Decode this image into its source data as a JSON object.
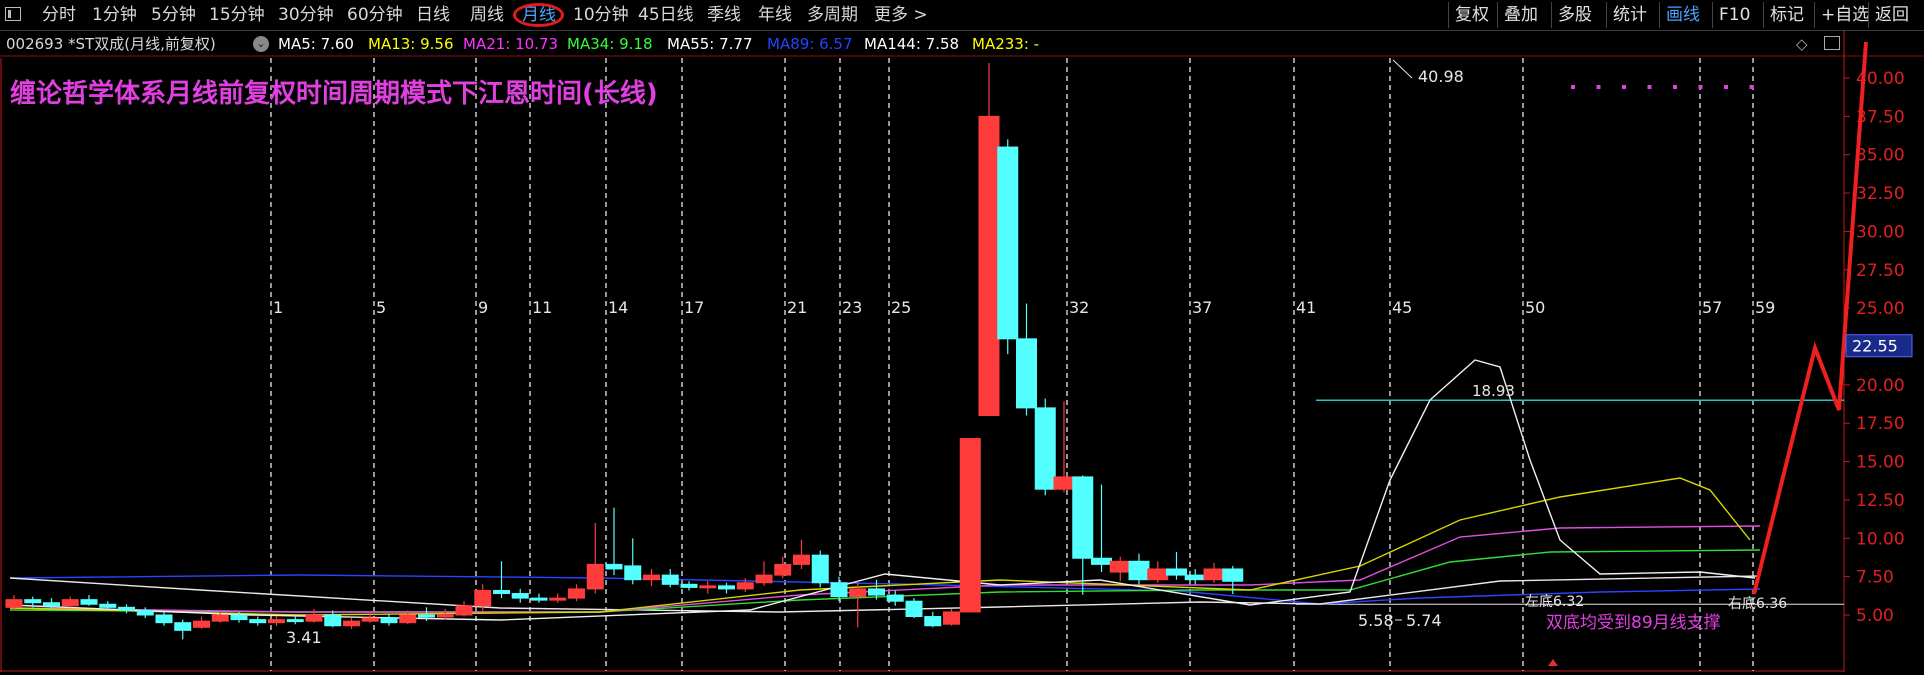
{
  "toolbar": {
    "periods": [
      "分时",
      "1分钟",
      "5分钟",
      "15分钟",
      "30分钟",
      "60分钟",
      "日线",
      "周线",
      "月线",
      "10分钟",
      "45日线",
      "季线",
      "年线",
      "多周期",
      "更多 >"
    ],
    "active_period": "月线",
    "right_buttons": [
      "复权",
      "叠加",
      "多股",
      "统计",
      "画线",
      "F10",
      "标记",
      "+自选",
      "返回"
    ],
    "active_right": "画线"
  },
  "info": {
    "stock": "002693 *ST双成(月线,前复权)",
    "ma": [
      {
        "label": "MA5: 7.60",
        "color": "#ffffff"
      },
      {
        "label": "MA13: 9.56",
        "color": "#ffff00"
      },
      {
        "label": "MA21: 10.73",
        "color": "#ff33ff"
      },
      {
        "label": "MA34: 9.18",
        "color": "#33ff33"
      },
      {
        "label": "MA55: 7.77",
        "color": "#ffffff"
      },
      {
        "label": "MA89: 6.57",
        "color": "#2244ff"
      },
      {
        "label": "MA144: 7.58",
        "color": "#ffffff"
      },
      {
        "label": "MA233: -",
        "color": "#ffff00"
      }
    ]
  },
  "annotation_title": "缠论哲学体系月线前复权时间周期模式下江恩时间(长线)",
  "annotation_note": "双底均受到89月线支撑",
  "chart_data": {
    "type": "candlestick",
    "price_axis": {
      "ticks": [
        5.0,
        7.5,
        10.0,
        12.5,
        15.0,
        17.5,
        20.0,
        22.5,
        25.0,
        27.5,
        30.0,
        32.5,
        35.0,
        37.5,
        40.0
      ],
      "tick_labels": [
        "5.00",
        "7.50",
        "10.00",
        "12.50",
        "15.00",
        "17.50",
        "20.00",
        "22.50",
        "25.00",
        "27.50",
        "30.00",
        "32.50",
        "35.00",
        "37.50",
        "40.00"
      ],
      "range": [
        3.3,
        42.0
      ]
    },
    "time_marks": [
      "1",
      "5",
      "9",
      "11",
      "14",
      "17",
      "21",
      "23",
      "25",
      "32",
      "37",
      "41",
      "45",
      "50",
      "57",
      "59"
    ],
    "current_price_tag": "22.55",
    "horizontal_line": 19.0,
    "price_labels": {
      "high": "40.98",
      "low": "3.41",
      "low2": "5.58",
      "low3": "5.74",
      "mid": "18.93",
      "left_bottom": "左底6.32",
      "right_bottom": "右底6.36"
    },
    "candles": [
      [
        0,
        5.5,
        6.0,
        6.3,
        5.3
      ],
      [
        1,
        6.0,
        5.8,
        6.2,
        5.5
      ],
      [
        2,
        5.8,
        5.6,
        6.1,
        5.4
      ],
      [
        3,
        5.6,
        6.0,
        6.2,
        5.5
      ],
      [
        4,
        6.0,
        5.7,
        6.3,
        5.6
      ],
      [
        5,
        5.7,
        5.5,
        5.9,
        5.3
      ],
      [
        6,
        5.5,
        5.3,
        5.7,
        5.1
      ],
      [
        7,
        5.3,
        5.0,
        5.5,
        4.8
      ],
      [
        8,
        5.0,
        4.5,
        5.2,
        4.3
      ],
      [
        9,
        4.5,
        4.0,
        4.7,
        3.41
      ],
      [
        10,
        4.2,
        4.6,
        4.9,
        4.1
      ],
      [
        11,
        4.6,
        5.0,
        5.3,
        4.5
      ],
      [
        12,
        5.0,
        4.7,
        5.2,
        4.5
      ],
      [
        13,
        4.7,
        4.5,
        4.9,
        4.3
      ],
      [
        14,
        4.5,
        4.7,
        4.9,
        4.3
      ],
      [
        15,
        4.7,
        4.6,
        5.0,
        4.4
      ],
      [
        16,
        4.6,
        5.0,
        5.4,
        4.5
      ],
      [
        17,
        5.0,
        4.3,
        5.3,
        4.2
      ],
      [
        18,
        4.3,
        4.6,
        4.8,
        4.1
      ],
      [
        19,
        4.6,
        4.8,
        5.2,
        4.5
      ],
      [
        20,
        4.8,
        4.5,
        5.1,
        4.3
      ],
      [
        21,
        4.5,
        5.0,
        5.3,
        4.4
      ],
      [
        22,
        5.0,
        4.9,
        5.5,
        4.6
      ],
      [
        23,
        4.9,
        5.0,
        5.4,
        4.7
      ],
      [
        24,
        5.0,
        5.6,
        5.9,
        4.9
      ],
      [
        25,
        5.6,
        6.6,
        7.0,
        5.2
      ],
      [
        26,
        6.6,
        6.4,
        8.5,
        6.1
      ],
      [
        27,
        6.4,
        6.1,
        6.7,
        5.8
      ],
      [
        28,
        6.1,
        6.0,
        6.4,
        5.8
      ],
      [
        29,
        6.0,
        6.1,
        6.4,
        5.8
      ],
      [
        30,
        6.1,
        6.7,
        7.0,
        5.9
      ],
      [
        31,
        6.7,
        8.3,
        11.0,
        6.4
      ],
      [
        32,
        8.3,
        8.0,
        12.0,
        7.6
      ],
      [
        33,
        8.2,
        7.3,
        10.0,
        7.0
      ],
      [
        34,
        7.3,
        7.6,
        8.0,
        6.9
      ],
      [
        35,
        7.6,
        7.0,
        8.0,
        6.8
      ],
      [
        36,
        7.0,
        6.8,
        7.2,
        6.6
      ],
      [
        37,
        6.8,
        6.9,
        7.2,
        6.4
      ],
      [
        38,
        6.9,
        6.7,
        7.1,
        6.4
      ],
      [
        39,
        6.7,
        7.1,
        7.4,
        6.5
      ],
      [
        40,
        7.1,
        7.6,
        8.5,
        6.9
      ],
      [
        41,
        7.6,
        8.3,
        8.8,
        7.4
      ],
      [
        42,
        8.3,
        8.9,
        9.9,
        8.0
      ],
      [
        43,
        8.9,
        7.1,
        9.2,
        6.8
      ],
      [
        44,
        7.1,
        6.2,
        7.5,
        5.9
      ],
      [
        45,
        6.2,
        6.7,
        7.2,
        4.2
      ],
      [
        46,
        6.7,
        6.3,
        7.3,
        6.0
      ],
      [
        47,
        6.3,
        5.9,
        6.6,
        5.6
      ],
      [
        48,
        5.9,
        4.9,
        6.1,
        4.8
      ],
      [
        49,
        4.9,
        4.3,
        5.2,
        4.2
      ],
      [
        50,
        4.4,
        5.2,
        5.4,
        4.3
      ],
      [
        51,
        5.2,
        16.5,
        16.5,
        5.58
      ],
      [
        52,
        18.0,
        37.5,
        40.98,
        18.0
      ],
      [
        53,
        35.5,
        23.0,
        36.0,
        22.0
      ],
      [
        54,
        23.0,
        18.5,
        25.3,
        18.0
      ],
      [
        55,
        18.5,
        13.2,
        19.1,
        12.8
      ],
      [
        56,
        13.2,
        14.0,
        18.93,
        13.0
      ],
      [
        57,
        14.0,
        8.7,
        14.1,
        6.32
      ],
      [
        58,
        8.7,
        8.3,
        13.5,
        7.8
      ],
      [
        59,
        7.8,
        8.5,
        8.8,
        7.2
      ],
      [
        60,
        8.5,
        7.3,
        9.0,
        7.0
      ],
      [
        61,
        7.3,
        8.0,
        8.5,
        7.1
      ],
      [
        62,
        8.0,
        7.6,
        9.1,
        7.3
      ],
      [
        63,
        7.6,
        7.3,
        8.0,
        7.0
      ],
      [
        64,
        7.3,
        8.0,
        8.4,
        7.1
      ],
      [
        65,
        8.0,
        7.2,
        8.2,
        6.36
      ]
    ]
  }
}
